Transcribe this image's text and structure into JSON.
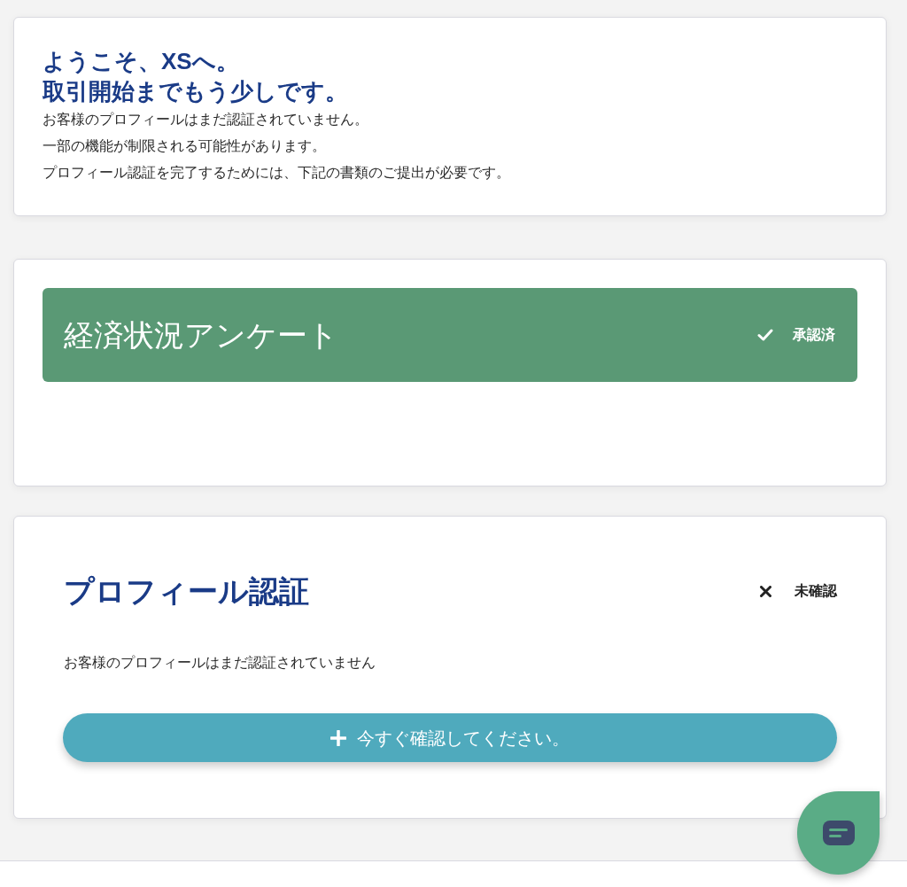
{
  "welcome": {
    "heading_lines": [
      "ようこそ、XSへ。",
      "取引開始までもう少しです。"
    ],
    "body_lines": [
      "お客様のプロフィールはまだ認証されていません。",
      "一部の機能が制限される可能性があります。",
      "プロフィール認証を完了するためには、下記の書類のご提出が必要です。"
    ]
  },
  "sections": [
    {
      "kind": "approved",
      "title": "経済状況アンケート",
      "status": "承認済"
    },
    {
      "kind": "unconfirmed",
      "title": "プロフィール認証",
      "status": "未確認",
      "description": "お客様のプロフィールはまだ認証されていません",
      "button": {
        "label": "今すぐ確認してください。"
      }
    }
  ]
}
